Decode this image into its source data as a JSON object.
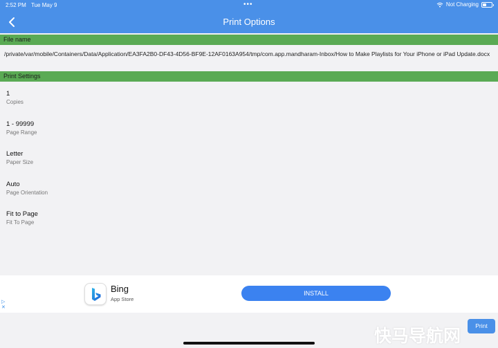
{
  "status": {
    "time": "2:52 PM",
    "date": "Tue May 9",
    "network": "Not Charging"
  },
  "header": {
    "title": "Print Options"
  },
  "file": {
    "section_label": "File name",
    "path": "/private/var/mobile/Containers/Data/Application/EA3FA2B0-DF43-4D56-BF9E-12AF0163A954/tmp/com.app.mandharam-Inbox/How to Make Playlists for Your iPhone or iPad Update.docx"
  },
  "settings": {
    "section_label": "Print Settings",
    "items": [
      {
        "value": "1",
        "label": "Copies"
      },
      {
        "value": "1 - 99999",
        "label": "Page Range"
      },
      {
        "value": "Letter",
        "label": "Paper Size"
      },
      {
        "value": "Auto",
        "label": "Page Orientation"
      },
      {
        "value": "Fit to Page",
        "label": "Fit To Page"
      }
    ]
  },
  "ad": {
    "app_name": "Bing",
    "store": "App Store",
    "button": "INSTALL"
  },
  "actions": {
    "print": "Print"
  },
  "watermark": "快马导航网",
  "colors": {
    "header": "#4a90e8",
    "section": "#5aaa54",
    "install": "#3b82f0"
  }
}
